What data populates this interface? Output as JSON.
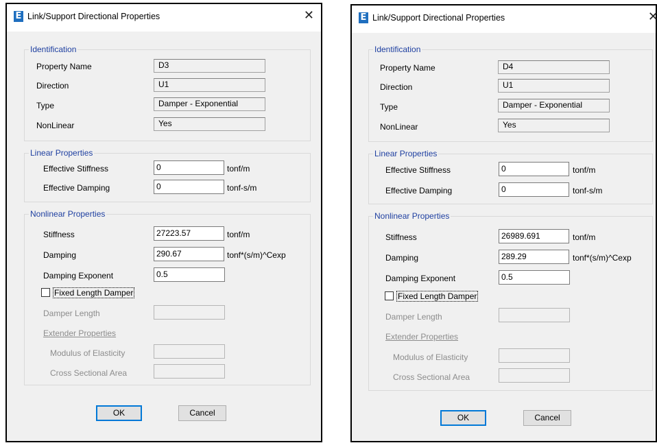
{
  "dialogs": [
    {
      "title": "Link/Support Directional Properties",
      "identification": {
        "legend": "Identification",
        "property_name_label": "Property Name",
        "property_name": "D3",
        "direction_label": "Direction",
        "direction": "U1",
        "type_label": "Type",
        "type": "Damper - Exponential",
        "nonlinear_label": "NonLinear",
        "nonlinear": "Yes"
      },
      "linear": {
        "legend": "Linear Properties",
        "eff_stiffness_label": "Effective Stiffness",
        "eff_stiffness": "0",
        "eff_stiffness_unit": "tonf/m",
        "eff_damping_label": "Effective Damping",
        "eff_damping": "0",
        "eff_damping_unit": "tonf-s/m"
      },
      "nonlinear": {
        "legend": "Nonlinear Properties",
        "stiffness_label": "Stiffness",
        "stiffness": "27223.57",
        "stiffness_unit": "tonf/m",
        "damping_label": "Damping",
        "damping": "290.67",
        "damping_unit": "tonf*(s/m)^Cexp",
        "damping_exponent_label": "Damping Exponent",
        "damping_exponent": "0.5",
        "fixed_length_label": "Fixed Length Damper",
        "damper_length_label": "Damper Length",
        "extender_label": "Extender Properties",
        "modulus_label": "Modulus of Elasticity",
        "area_label": "Cross Sectional Area"
      },
      "ok_label": "OK",
      "cancel_label": "Cancel"
    },
    {
      "title": "Link/Support Directional Properties",
      "identification": {
        "legend": "Identification",
        "property_name_label": "Property Name",
        "property_name": "D4",
        "direction_label": "Direction",
        "direction": "U1",
        "type_label": "Type",
        "type": "Damper - Exponential",
        "nonlinear_label": "NonLinear",
        "nonlinear": "Yes"
      },
      "linear": {
        "legend": "Linear Properties",
        "eff_stiffness_label": "Effective Stiffness",
        "eff_stiffness": "0",
        "eff_stiffness_unit": "tonf/m",
        "eff_damping_label": "Effective Damping",
        "eff_damping": "0",
        "eff_damping_unit": "tonf-s/m"
      },
      "nonlinear": {
        "legend": "Nonlinear Properties",
        "stiffness_label": "Stiffness",
        "stiffness": "26989.691",
        "stiffness_unit": "tonf/m",
        "damping_label": "Damping",
        "damping": "289.29",
        "damping_unit": "tonf*(s/m)^Cexp",
        "damping_exponent_label": "Damping Exponent",
        "damping_exponent": "0.5",
        "fixed_length_label": "Fixed Length Damper",
        "damper_length_label": "Damper Length",
        "extender_label": "Extender Properties",
        "modulus_label": "Modulus of Elasticity",
        "area_label": "Cross Sectional Area"
      },
      "ok_label": "OK",
      "cancel_label": "Cancel"
    }
  ],
  "icons": {
    "app": "etabs-app-icon",
    "close": "close-icon",
    "checkbox": "checkbox-icon"
  },
  "colors": {
    "legend": "#1e3fa0",
    "app_icon": "#1f6fbf",
    "default_button_border": "#0078d7"
  }
}
